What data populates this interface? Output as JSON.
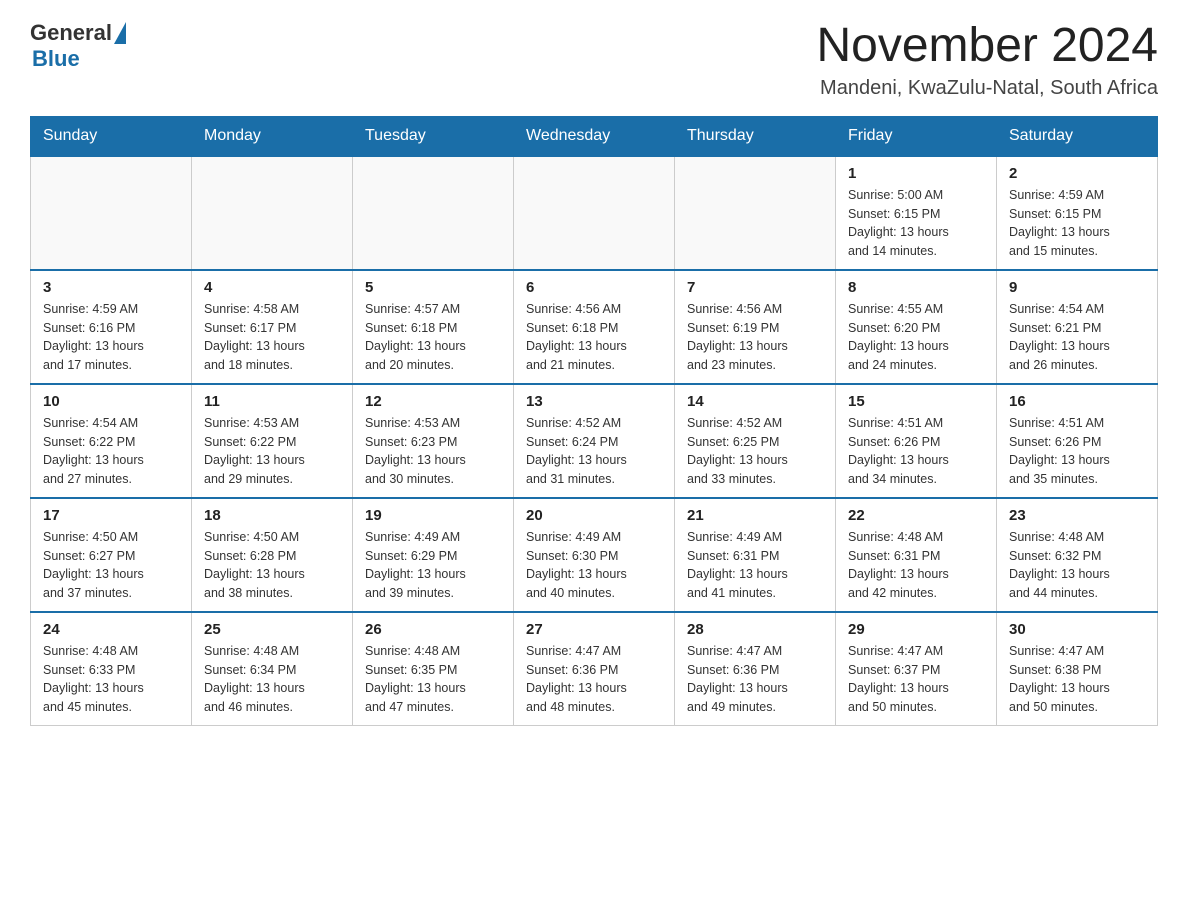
{
  "header": {
    "logo_general": "General",
    "logo_blue": "Blue",
    "month_title": "November 2024",
    "location": "Mandeni, KwaZulu-Natal, South Africa"
  },
  "days_of_week": [
    "Sunday",
    "Monday",
    "Tuesday",
    "Wednesday",
    "Thursday",
    "Friday",
    "Saturday"
  ],
  "weeks": [
    [
      {
        "day": "",
        "info": ""
      },
      {
        "day": "",
        "info": ""
      },
      {
        "day": "",
        "info": ""
      },
      {
        "day": "",
        "info": ""
      },
      {
        "day": "",
        "info": ""
      },
      {
        "day": "1",
        "info": "Sunrise: 5:00 AM\nSunset: 6:15 PM\nDaylight: 13 hours\nand 14 minutes."
      },
      {
        "day": "2",
        "info": "Sunrise: 4:59 AM\nSunset: 6:15 PM\nDaylight: 13 hours\nand 15 minutes."
      }
    ],
    [
      {
        "day": "3",
        "info": "Sunrise: 4:59 AM\nSunset: 6:16 PM\nDaylight: 13 hours\nand 17 minutes."
      },
      {
        "day": "4",
        "info": "Sunrise: 4:58 AM\nSunset: 6:17 PM\nDaylight: 13 hours\nand 18 minutes."
      },
      {
        "day": "5",
        "info": "Sunrise: 4:57 AM\nSunset: 6:18 PM\nDaylight: 13 hours\nand 20 minutes."
      },
      {
        "day": "6",
        "info": "Sunrise: 4:56 AM\nSunset: 6:18 PM\nDaylight: 13 hours\nand 21 minutes."
      },
      {
        "day": "7",
        "info": "Sunrise: 4:56 AM\nSunset: 6:19 PM\nDaylight: 13 hours\nand 23 minutes."
      },
      {
        "day": "8",
        "info": "Sunrise: 4:55 AM\nSunset: 6:20 PM\nDaylight: 13 hours\nand 24 minutes."
      },
      {
        "day": "9",
        "info": "Sunrise: 4:54 AM\nSunset: 6:21 PM\nDaylight: 13 hours\nand 26 minutes."
      }
    ],
    [
      {
        "day": "10",
        "info": "Sunrise: 4:54 AM\nSunset: 6:22 PM\nDaylight: 13 hours\nand 27 minutes."
      },
      {
        "day": "11",
        "info": "Sunrise: 4:53 AM\nSunset: 6:22 PM\nDaylight: 13 hours\nand 29 minutes."
      },
      {
        "day": "12",
        "info": "Sunrise: 4:53 AM\nSunset: 6:23 PM\nDaylight: 13 hours\nand 30 minutes."
      },
      {
        "day": "13",
        "info": "Sunrise: 4:52 AM\nSunset: 6:24 PM\nDaylight: 13 hours\nand 31 minutes."
      },
      {
        "day": "14",
        "info": "Sunrise: 4:52 AM\nSunset: 6:25 PM\nDaylight: 13 hours\nand 33 minutes."
      },
      {
        "day": "15",
        "info": "Sunrise: 4:51 AM\nSunset: 6:26 PM\nDaylight: 13 hours\nand 34 minutes."
      },
      {
        "day": "16",
        "info": "Sunrise: 4:51 AM\nSunset: 6:26 PM\nDaylight: 13 hours\nand 35 minutes."
      }
    ],
    [
      {
        "day": "17",
        "info": "Sunrise: 4:50 AM\nSunset: 6:27 PM\nDaylight: 13 hours\nand 37 minutes."
      },
      {
        "day": "18",
        "info": "Sunrise: 4:50 AM\nSunset: 6:28 PM\nDaylight: 13 hours\nand 38 minutes."
      },
      {
        "day": "19",
        "info": "Sunrise: 4:49 AM\nSunset: 6:29 PM\nDaylight: 13 hours\nand 39 minutes."
      },
      {
        "day": "20",
        "info": "Sunrise: 4:49 AM\nSunset: 6:30 PM\nDaylight: 13 hours\nand 40 minutes."
      },
      {
        "day": "21",
        "info": "Sunrise: 4:49 AM\nSunset: 6:31 PM\nDaylight: 13 hours\nand 41 minutes."
      },
      {
        "day": "22",
        "info": "Sunrise: 4:48 AM\nSunset: 6:31 PM\nDaylight: 13 hours\nand 42 minutes."
      },
      {
        "day": "23",
        "info": "Sunrise: 4:48 AM\nSunset: 6:32 PM\nDaylight: 13 hours\nand 44 minutes."
      }
    ],
    [
      {
        "day": "24",
        "info": "Sunrise: 4:48 AM\nSunset: 6:33 PM\nDaylight: 13 hours\nand 45 minutes."
      },
      {
        "day": "25",
        "info": "Sunrise: 4:48 AM\nSunset: 6:34 PM\nDaylight: 13 hours\nand 46 minutes."
      },
      {
        "day": "26",
        "info": "Sunrise: 4:48 AM\nSunset: 6:35 PM\nDaylight: 13 hours\nand 47 minutes."
      },
      {
        "day": "27",
        "info": "Sunrise: 4:47 AM\nSunset: 6:36 PM\nDaylight: 13 hours\nand 48 minutes."
      },
      {
        "day": "28",
        "info": "Sunrise: 4:47 AM\nSunset: 6:36 PM\nDaylight: 13 hours\nand 49 minutes."
      },
      {
        "day": "29",
        "info": "Sunrise: 4:47 AM\nSunset: 6:37 PM\nDaylight: 13 hours\nand 50 minutes."
      },
      {
        "day": "30",
        "info": "Sunrise: 4:47 AM\nSunset: 6:38 PM\nDaylight: 13 hours\nand 50 minutes."
      }
    ]
  ]
}
